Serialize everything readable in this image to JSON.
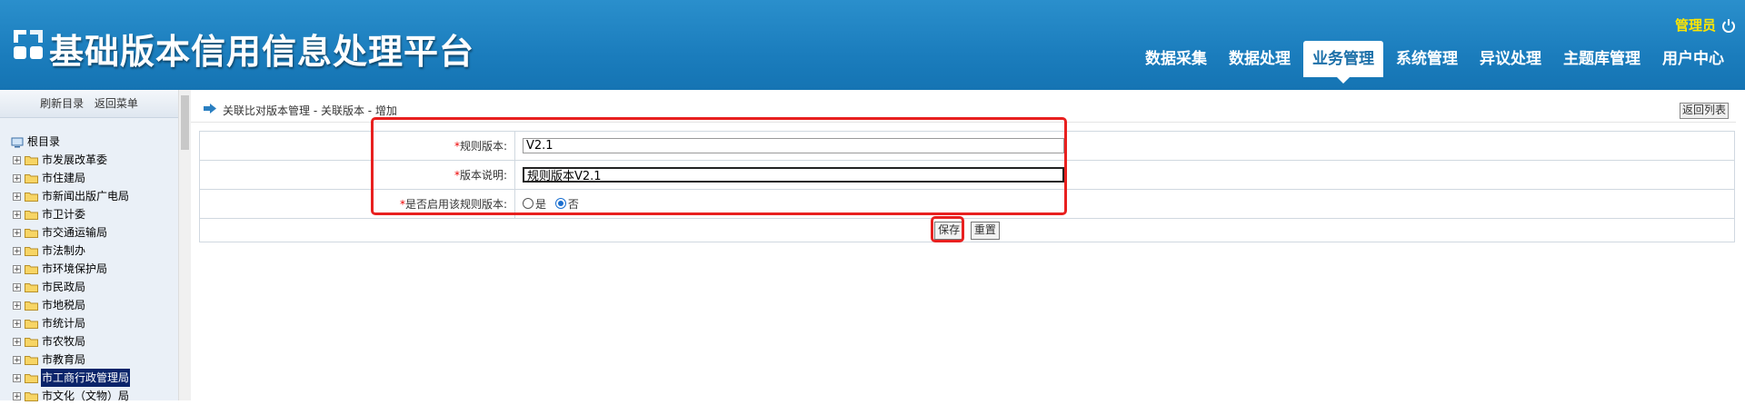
{
  "header": {
    "title": "基础版本信用信息处理平台",
    "user": "管理员",
    "nav": [
      "数据采集",
      "数据处理",
      "业务管理",
      "系统管理",
      "异议处理",
      "主题库管理",
      "用户中心"
    ],
    "active_nav_index": 2
  },
  "sidebar": {
    "refresh_label": "刷新目录",
    "back_menu_label": "返回菜单",
    "root_label": "根目录",
    "items": [
      {
        "label": "市发展改革委"
      },
      {
        "label": "市住建局"
      },
      {
        "label": "市新闻出版广电局"
      },
      {
        "label": "市卫计委"
      },
      {
        "label": "市交通运输局"
      },
      {
        "label": "市法制办"
      },
      {
        "label": "市环境保护局"
      },
      {
        "label": "市民政局"
      },
      {
        "label": "市地税局"
      },
      {
        "label": "市统计局"
      },
      {
        "label": "市农牧局"
      },
      {
        "label": "市教育局"
      },
      {
        "label": "市工商行政管理局",
        "selected": true
      },
      {
        "label": "市文化（文物）局"
      }
    ]
  },
  "main": {
    "breadcrumb": "关联比对版本管理 - 关联版本 - 增加",
    "back_list_label": "返回列表",
    "form": {
      "rule_version_label": "规则版本:",
      "rule_version_value": "V2.1",
      "version_desc_label": "版本说明:",
      "version_desc_value": "规则版本V2.1",
      "enable_label": "是否启用该规则版本:",
      "yes_label": "是",
      "no_label": "否",
      "enabled": "否",
      "required_mark": "*"
    },
    "save_label": "保存",
    "reset_label": "重置"
  },
  "colors": {
    "header_blue": "#1b7dbd",
    "user_yellow": "#ffe600",
    "annotation_red": "#e8201f",
    "selected_bg": "#0a246a"
  }
}
